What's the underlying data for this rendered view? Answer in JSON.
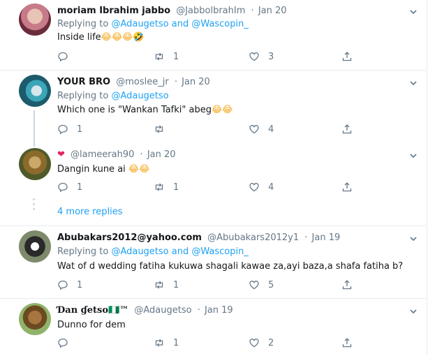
{
  "tweets": [
    {
      "name": "moriam Ibrahim jabbo",
      "handle": "@JabbolbrahIm",
      "time": "Jan 20",
      "replying_prefix": "Replying to ",
      "replying_to": "@Adaugetso and @Wascopin_",
      "text": "Inside life",
      "emoji": "😂😂😂🤣",
      "reply_count": "",
      "retweet_count": "1",
      "like_count": "3"
    },
    {
      "name": "YOUR BRO",
      "handle": "@moslee_jr",
      "time": "Jan 20",
      "replying_prefix": "Replying to ",
      "replying_to": "@Adaugetso",
      "text": "Which one is \"Wankan Tafki\" abeg",
      "emoji": "😂😂",
      "reply_count": "1",
      "retweet_count": "",
      "like_count": "4"
    },
    {
      "name": "❤",
      "handle": "@lameerah90",
      "time": "Jan 20",
      "text": "Dangin kune ai ",
      "emoji": "😂😂",
      "reply_count": "1",
      "retweet_count": "1",
      "like_count": "4"
    },
    {
      "name": "Abubakars2012@yahoo.com",
      "handle": "@Abubakars2012y1",
      "time": "Jan 19",
      "replying_prefix": "Replying to ",
      "replying_to": "@Adaugetso and @Wascopin_",
      "text": "Wat of d wedding fatiha  kukuwa shagali kawae za,ayi baza,a shafa fatiha b?",
      "reply_count": "1",
      "retweet_count": "1",
      "like_count": "5"
    },
    {
      "name": "Ɗan ɠetso🇳🇬™",
      "handle": "@Adaugetso",
      "time": "Jan 19",
      "text": "Dunno for dem",
      "reply_count": "",
      "retweet_count": "1",
      "like_count": "2"
    }
  ],
  "more_replies": "4 more replies",
  "separator": "·",
  "colors": {
    "accent": "#1da1f2",
    "muted": "#657786",
    "like_red": "#e0245e"
  }
}
